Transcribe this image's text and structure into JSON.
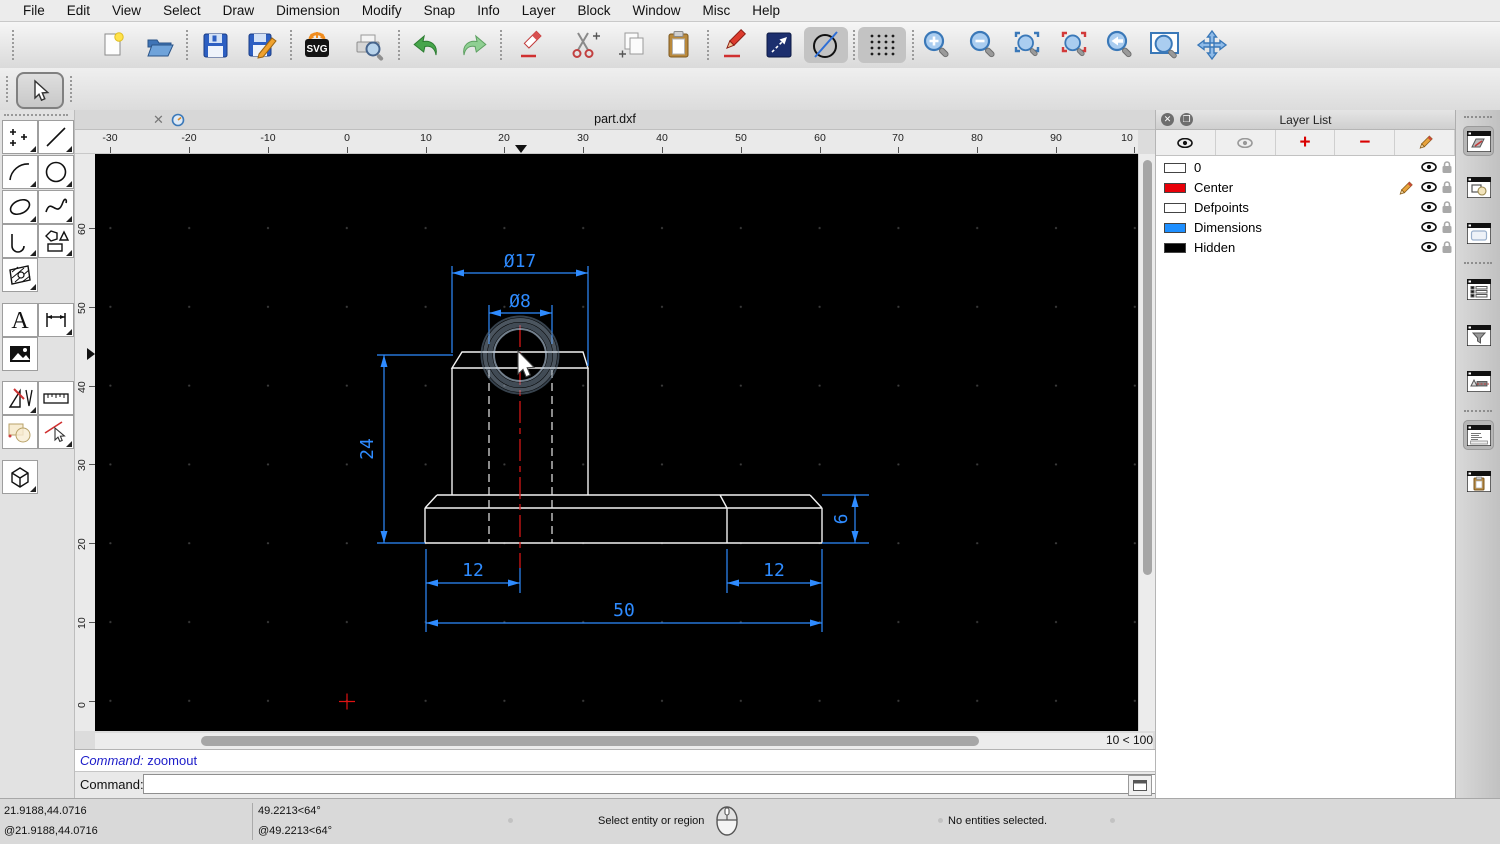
{
  "menu": {
    "items": [
      "File",
      "Edit",
      "View",
      "Select",
      "Draw",
      "Dimension",
      "Modify",
      "Snap",
      "Info",
      "Layer",
      "Block",
      "Window",
      "Misc",
      "Help"
    ]
  },
  "toolbar": {
    "icons": [
      "selection-pointer",
      "new-document",
      "open-file",
      "save",
      "save-as",
      "svg-export",
      "print-preview",
      "undo",
      "redo",
      "erase",
      "cut",
      "copy",
      "paste",
      "freehand-pen",
      "line-arrow",
      "circle-line-tool",
      "grid-toggle",
      "zoom-in",
      "zoom-out",
      "auto-zoom",
      "zoom-selection",
      "previous-view",
      "zoom-window",
      "pan"
    ]
  },
  "tool_palette": {
    "icons": [
      "points",
      "line",
      "arc",
      "circle",
      "ellipse",
      "spline",
      "polyline",
      "shapes",
      "hatch",
      "text",
      "dimension",
      "image",
      "cad-tools",
      "measure",
      "modify-shapes",
      "select-entities",
      "solid-box"
    ]
  },
  "document_tab": {
    "title": "part.dxf",
    "close_glyph": "✕"
  },
  "rulers": {
    "horizontal": [
      "-30",
      "-20",
      "-10",
      "0",
      "10",
      "20",
      "30",
      "40",
      "50",
      "60",
      "70",
      "80",
      "90",
      "10"
    ],
    "vertical": [
      "60",
      "50",
      "40",
      "30",
      "20",
      "10",
      "0"
    ]
  },
  "viewport": {
    "zoom_indicator": "10 < 100"
  },
  "drawing": {
    "dims": {
      "outer_diameter": "Ø17",
      "hole_diameter": "Ø8",
      "boss_height": "24",
      "base_thickness": "6",
      "left_offset": "12",
      "right_offset": "12",
      "overall_width": "50"
    },
    "colors": {
      "geometry": "#f2f2f2",
      "dimension": "#2e8bff",
      "centerline": "#d31616"
    }
  },
  "layer_list": {
    "title": "Layer List",
    "layers": [
      {
        "name": "0",
        "color": "#ffffff"
      },
      {
        "name": "Center",
        "color": "#e80008"
      },
      {
        "name": "Defpoints",
        "color": "#ffffff"
      },
      {
        "name": "Dimensions",
        "color": "#1e8fff"
      },
      {
        "name": "Hidden",
        "color": "#000000"
      }
    ]
  },
  "dock": {
    "icons": [
      "layer-list-panel",
      "block-list-panel",
      "library-browser-panel",
      "entity-list-panel",
      "selection-filter-panel",
      "property-editor-panel",
      "command-line-panel",
      "clipboard-panel"
    ]
  },
  "command": {
    "history_label": "Command:",
    "history_entry": "zoomout",
    "prompt_label": "Command:",
    "input_value": ""
  },
  "status_bar": {
    "coord_abs": "21.9188,44.0716",
    "coord_rel": "@21.9188,44.0716",
    "polar_abs": "49.2213<64°",
    "polar_rel": "@49.2213<64°",
    "hint": "Select entity or region",
    "selection_info": "No entities selected."
  }
}
